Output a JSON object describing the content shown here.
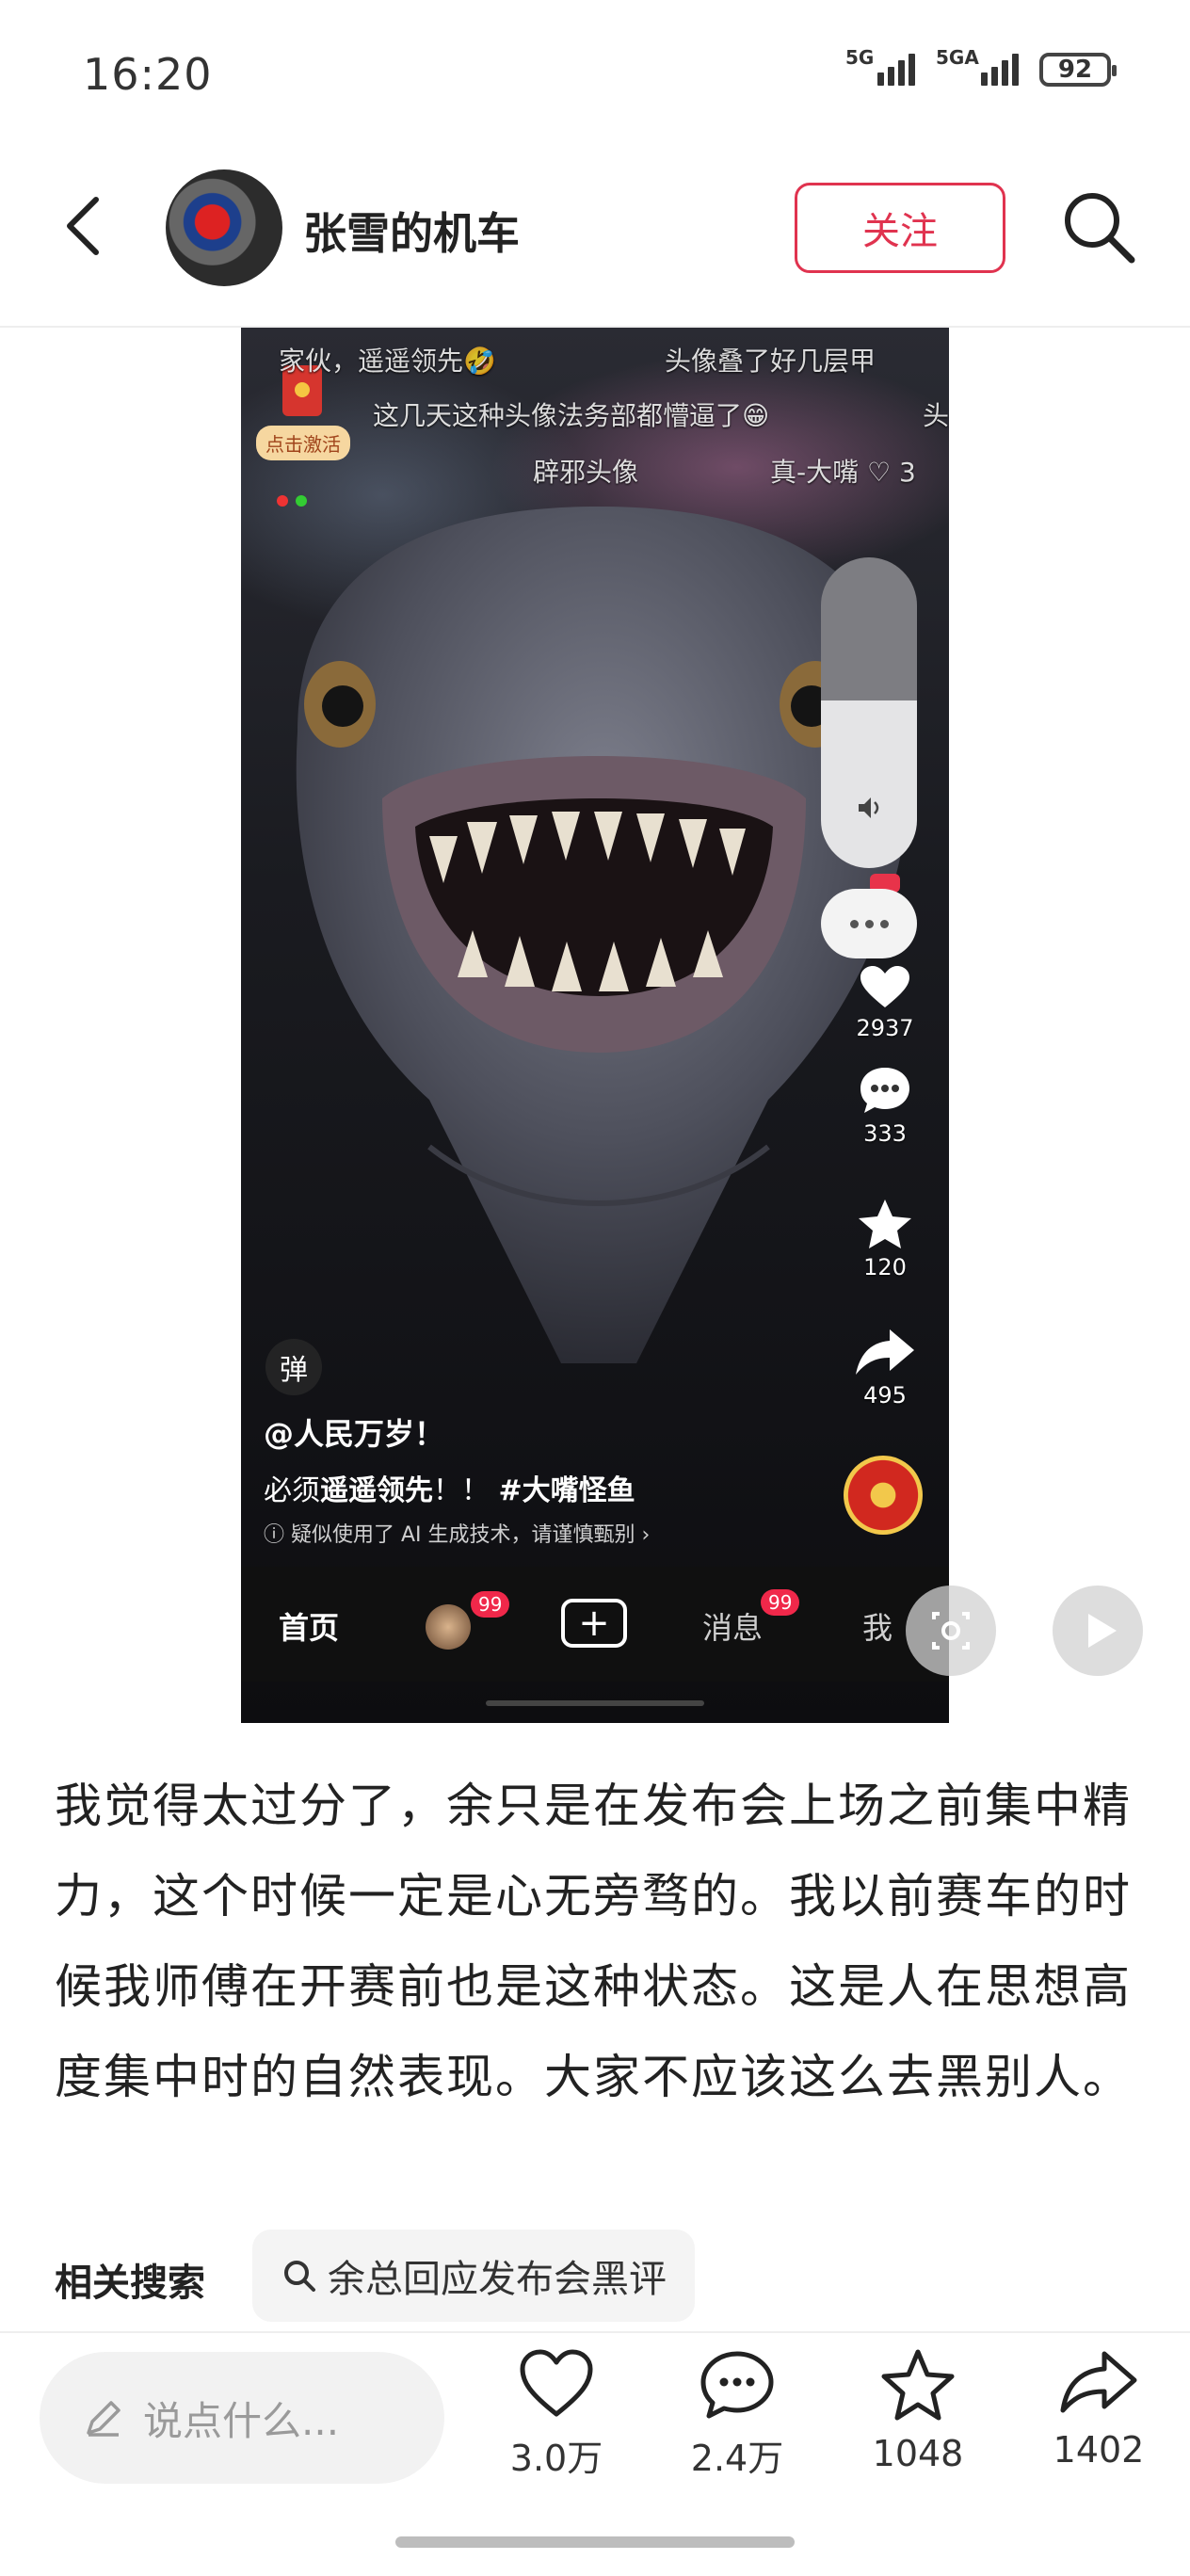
{
  "status_bar": {
    "time": "16:20",
    "signal_1_label": "5G",
    "signal_2_label": "5GA",
    "battery": "92"
  },
  "header": {
    "back_icon": "chevron-left-icon",
    "author_name": "张雪的机车",
    "follow_label": "关注",
    "search_icon": "search-icon"
  },
  "image": {
    "danmu": [
      "家伙，遥遥领先🤣",
      "头像叠了好几层甲",
      "这几天这种头像法务部都懵逼了😁",
      "头",
      "辟邪头像",
      "真-大嘴 ♡ 3"
    ],
    "activate_label": "点击激活",
    "stats": {
      "likes": "2937",
      "comments": "333",
      "favorites": "120",
      "shares": "495"
    },
    "danmu_toggle": "弹",
    "video_author": "@人民万岁！",
    "video_desc_prefix": "必须",
    "video_desc_emph": "遥遥领先",
    "video_desc_mid": "！！",
    "video_desc_tag": "#大嘴怪鱼",
    "ai_notice": "疑似使用了 AI 生成技术，请谨慎甄别 ›",
    "nav": {
      "home": "首页",
      "friends_badge": "99",
      "messages": "消息",
      "messages_badge": "99",
      "me": "我"
    }
  },
  "post": {
    "text": "我觉得太过分了，余只是在发布会上场之前集中精力，这个时候一定是心无旁骛的。我以前赛车的时候我师傅在开赛前也是这种状态。这是人在思想高度集中时的自然表现。大家不应该这么去黑别人。"
  },
  "related": {
    "label": "相关搜索",
    "query": "余总回应发布会黑评"
  },
  "bottom_bar": {
    "comment_placeholder": "说点什么...",
    "likes": "3.0万",
    "comments": "2.4万",
    "favorites": "1048",
    "shares": "1402"
  },
  "colors": {
    "accent": "#e0334f",
    "text": "#222222",
    "muted": "#9a9a9a"
  }
}
